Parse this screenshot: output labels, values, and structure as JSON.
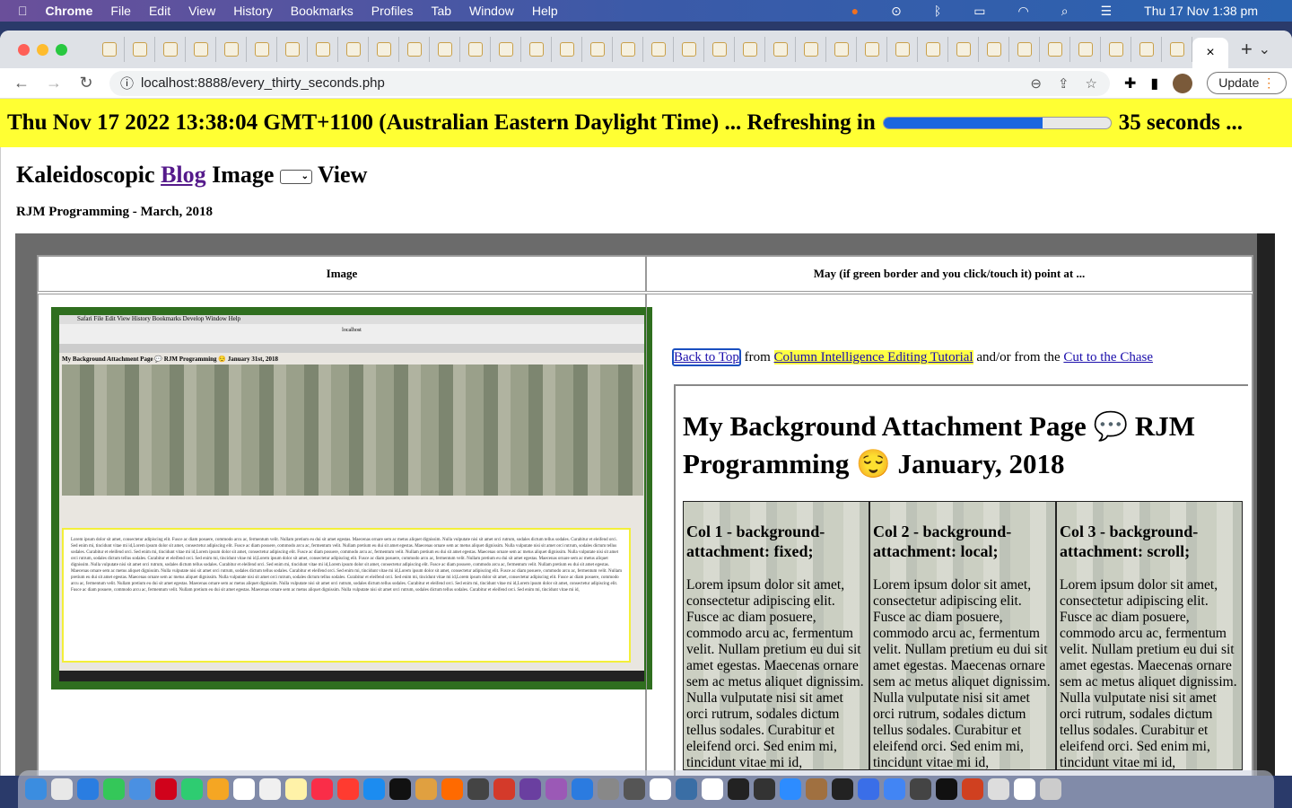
{
  "menubar": {
    "app": "Chrome",
    "items": [
      "File",
      "Edit",
      "View",
      "History",
      "Bookmarks",
      "Profiles",
      "Tab",
      "Window",
      "Help"
    ],
    "clock": "Thu 17 Nov  1:38 pm",
    "status_icons": [
      "elephant-icon",
      "play-icon",
      "bluetooth-icon",
      "battery-icon",
      "wifi-icon",
      "search-icon",
      "control-center-icon"
    ]
  },
  "tabs": {
    "count_favicons": 36,
    "active_close": "×",
    "new_tab": "+",
    "tab_search": "⌄"
  },
  "toolbar": {
    "url": "localhost:8888/every_thirty_seconds.php",
    "update_label": "Update"
  },
  "banner": {
    "datetime": "Thu Nov 17 2022 13:38:04 GMT+1100 (Australian Eastern Daylight Time) ... Refreshing in",
    "countdown": "35 seconds ...",
    "progress_percent": 70,
    "background": "#ffff33",
    "bar_color": "#1a66e0"
  },
  "page": {
    "title_pre": "Kaleidoscopic",
    "title_link": "Blog",
    "title_mid": "Image",
    "title_post": "View",
    "subtitle": "RJM Programming - March, 2018",
    "table": {
      "col1_header": "Image",
      "col2_header": "May (if green border and you click/touch it) point at ...",
      "links": {
        "back_to_top": "Back to Top",
        "from1": "from",
        "tutorial": "Column Intelligence Editing Tutorial",
        "from2": "and/or from the",
        "cut": "Cut to the Chase"
      },
      "inner_title": "My Background Attachment Page 💬 RJM Programming 😌 January, 2018",
      "columns": [
        {
          "heading": "Col 1 - background-attachment: fixed;",
          "text": "Lorem ipsum dolor sit amet, consectetur adipiscing elit. Fusce ac diam posuere, commodo arcu ac, fermentum velit. Nullam pretium eu dui sit amet egestas. Maecenas ornare sem ac metus aliquet dignissim. Nulla vulputate nisi sit amet orci rutrum, sodales dictum tellus sodales. Curabitur et eleifend orci. Sed enim mi, tincidunt vitae mi id,"
        },
        {
          "heading": "Col 2 - background-attachment: local;",
          "text": "Lorem ipsum dolor sit amet, consectetur adipiscing elit. Fusce ac diam posuere, commodo arcu ac, fermentum velit. Nullam pretium eu dui sit amet egestas. Maecenas ornare sem ac metus aliquet dignissim. Nulla vulputate nisi sit amet orci rutrum, sodales dictum tellus sodales. Curabitur et eleifend orci. Sed enim mi, tincidunt vitae mi id,"
        },
        {
          "heading": "Col 3 - background-attachment: scroll;",
          "text": "Lorem ipsum dolor sit amet, consectetur adipiscing elit. Fusce ac diam posuere, commodo arcu ac, fermentum velit. Nullam pretium eu dui sit amet egestas. Maecenas ornare sem ac metus aliquet dignissim. Nulla vulputate nisi sit amet orci rutrum, sodales dictum tellus sodales. Curabitur et eleifend orci. Sed enim mi, tincidunt vitae mi id,"
        }
      ],
      "screenshot": {
        "menubar": "Safari  File  Edit  View  History  Bookmarks  Develop  Window  Help",
        "url": "localhost",
        "title": "My Background Attachment Page 💬 RJM Programming 😌 January 31st, 2018"
      }
    }
  },
  "dock": {
    "colors": [
      "#3b8de0",
      "#e8e8e8",
      "#2a7de1",
      "#34c759",
      "#4a90e2",
      "#d0021b",
      "#2ecc71",
      "#f5a623",
      "#ffffff",
      "#f0f0f0",
      "#fff2a8",
      "#fa2d48",
      "#ff3b30",
      "#1c8cf0",
      "#111111",
      "#e0a040",
      "#ff6a00",
      "#444444",
      "#d43a2a",
      "#6a3fa0",
      "#9b59b6",
      "#2b7be0",
      "#888888",
      "#555555",
      "#ffffff",
      "#3a6ea5",
      "#ffffff",
      "#222222",
      "#333333",
      "#2d8cff",
      "#a07040",
      "#222222",
      "#3a6ee8",
      "#4285f4",
      "#444444",
      "#111111",
      "#d04020",
      "#dddddd",
      "#ffffff",
      "#cccccc"
    ]
  }
}
